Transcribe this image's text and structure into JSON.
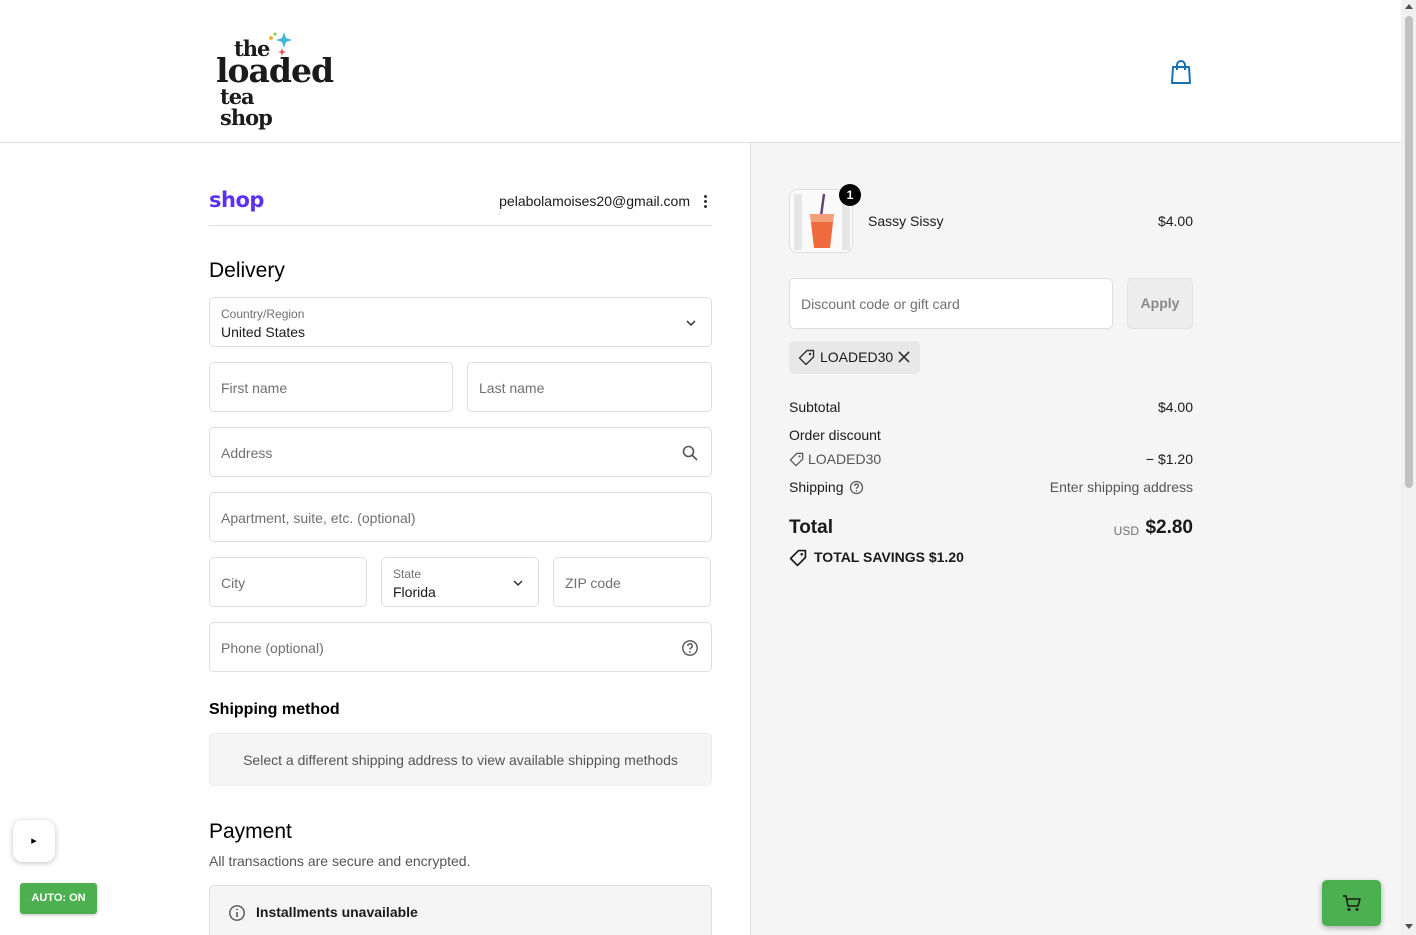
{
  "header": {
    "logo_lines": [
      "the",
      "loaded",
      "tea shop"
    ]
  },
  "account": {
    "shop_logo": "shop",
    "email": "pelabolamoises20@gmail.com"
  },
  "delivery": {
    "title": "Delivery",
    "country": {
      "label": "Country/Region",
      "value": "United States"
    },
    "first_name": {
      "placeholder": "First name"
    },
    "last_name": {
      "placeholder": "Last name"
    },
    "address": {
      "placeholder": "Address"
    },
    "apartment": {
      "placeholder": "Apartment, suite, etc. (optional)"
    },
    "city": {
      "placeholder": "City"
    },
    "state": {
      "label": "State",
      "value": "Florida"
    },
    "zip": {
      "placeholder": "ZIP code"
    },
    "phone": {
      "placeholder": "Phone (optional)"
    }
  },
  "shipping_method": {
    "title": "Shipping method",
    "note": "Select a different shipping address to view available shipping methods"
  },
  "payment": {
    "title": "Payment",
    "subtitle": "All transactions are secure and encrypted.",
    "installments": "Installments unavailable"
  },
  "summary": {
    "item": {
      "name": "Sassy Sissy",
      "price": "$4.00",
      "quantity": "1"
    },
    "discount_input": {
      "placeholder": "Discount code or gift card"
    },
    "apply_label": "Apply",
    "applied_code": "LOADED30",
    "subtotal": {
      "label": "Subtotal",
      "value": "$4.00"
    },
    "order_discount": {
      "label": "Order discount",
      "code": "LOADED30",
      "value": "− $1.20"
    },
    "shipping": {
      "label": "Shipping",
      "value": "Enter shipping address"
    },
    "total": {
      "label": "Total",
      "currency": "USD",
      "value": "$2.80"
    },
    "savings": "TOTAL SAVINGS  $1.20"
  },
  "overlays": {
    "play_label": "▸",
    "auto_label": "AUTO: ON"
  },
  "colors": {
    "shop_brand": "#5a31f4",
    "accent_blue": "#1773b0",
    "auto_green": "#4caf50"
  }
}
